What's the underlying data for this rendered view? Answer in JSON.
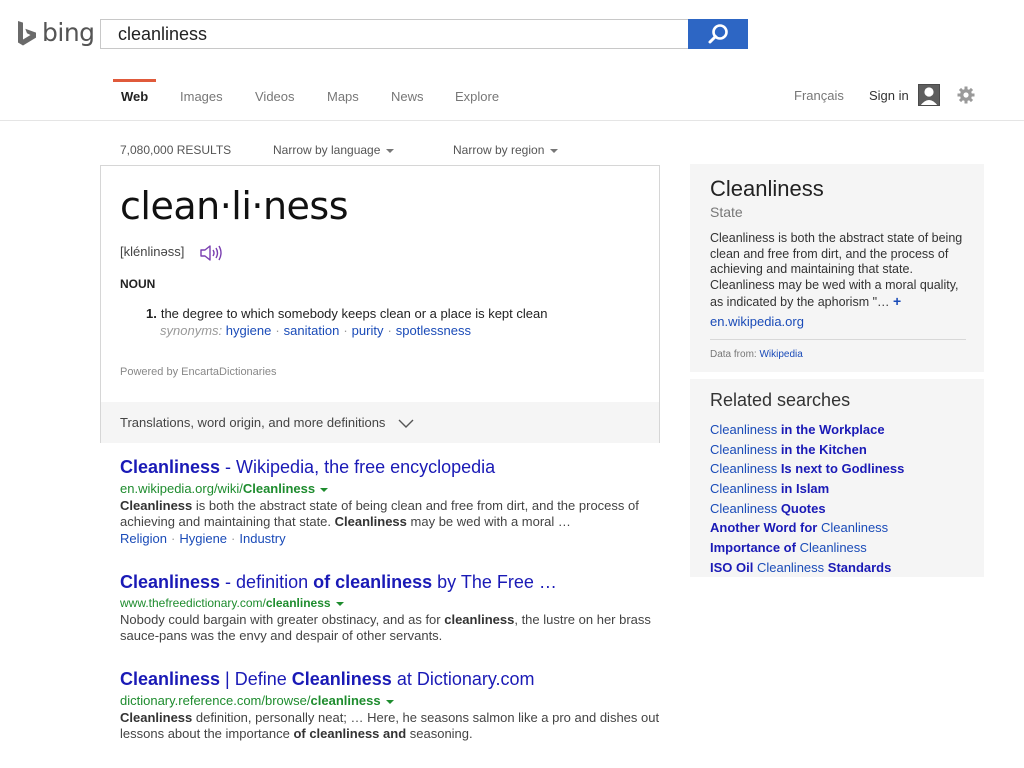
{
  "header": {
    "logo_text": "bing",
    "search_value": "cleanliness"
  },
  "nav": {
    "tabs": [
      {
        "label": "Web",
        "active": true
      },
      {
        "label": "Images"
      },
      {
        "label": "Videos"
      },
      {
        "label": "Maps"
      },
      {
        "label": "News"
      },
      {
        "label": "Explore"
      }
    ],
    "language": "Français",
    "signin": "Sign in"
  },
  "meta": {
    "results_count": "7,080,000 RESULTS",
    "narrow_language": "Narrow by language",
    "narrow_region": "Narrow by region"
  },
  "dictionary": {
    "word": "clean·li·ness",
    "pronunciation": "[klénlinəss]",
    "part_of_speech": "NOUN",
    "definition_number": "1.",
    "definition": "the degree to which somebody keeps clean or a place is kept clean",
    "synonyms_label": "synonyms:",
    "synonyms": [
      "hygiene",
      "sanitation",
      "purity",
      "spotlessness"
    ],
    "powered_by": "Powered by EncartaDictionaries",
    "more_label": "Translations, word origin, and more definitions"
  },
  "results": [
    {
      "title_bold": "Cleanliness",
      "title_rest": " - Wikipedia, the free encyclopedia",
      "url_plain": "en.wikipedia.org/wiki/",
      "url_bold": "Cleanliness",
      "snippet": [
        {
          "b": "Cleanliness"
        },
        {
          "t": " is both the abstract state of being clean and free from dirt, and the process of achieving and maintaining that state. "
        },
        {
          "b": "Cleanliness"
        },
        {
          "t": " may be wed with a moral …"
        }
      ],
      "deeplinks": [
        "Religion",
        "Hygiene",
        "Industry"
      ]
    },
    {
      "title_parts": [
        {
          "b": "Cleanliness"
        },
        {
          "t": " - definition "
        },
        {
          "b": "of cleanliness"
        },
        {
          "t": " by The Free …"
        }
      ],
      "url_plain": "www.thefreedictionary.com/",
      "url_bold": "cleanliness",
      "snippet": [
        {
          "t": "Nobody could bargain with greater obstinacy, and as for "
        },
        {
          "b": "cleanliness"
        },
        {
          "t": ", the lustre on her brass sauce-pans was the envy and despair of other servants."
        }
      ]
    },
    {
      "title_parts": [
        {
          "b": "Cleanliness"
        },
        {
          "t": " | Define "
        },
        {
          "b": "Cleanliness"
        },
        {
          "t": " at Dictionary.com"
        }
      ],
      "url_plain": "dictionary.reference.com/browse/",
      "url_bold": "cleanliness",
      "snippet": [
        {
          "b": "Cleanliness"
        },
        {
          "t": " definition, personally neat; … Here, he seasons salmon like a pro and dishes out lessons about the importance "
        },
        {
          "b": "of cleanliness and"
        },
        {
          "t": " seasoning."
        }
      ]
    }
  ],
  "knowledge_panel": {
    "title": "Cleanliness",
    "subtitle": "State",
    "description": "Cleanliness is both the abstract state of being clean and free from dirt, and the process of achieving and maintaining that state. Cleanliness may be wed with a moral quality, as indicated by the aphorism \"…",
    "more": "+",
    "link": "en.wikipedia.org",
    "source_label": "Data from:",
    "source_link": "Wikipedia"
  },
  "related": {
    "title": "Related searches",
    "items": [
      [
        {
          "t": "Cleanliness"
        },
        {
          "b": " in the Workplace"
        }
      ],
      [
        {
          "t": "Cleanliness"
        },
        {
          "b": " in the Kitchen"
        }
      ],
      [
        {
          "t": "Cleanliness"
        },
        {
          "b": " Is next to Godliness"
        }
      ],
      [
        {
          "t": "Cleanliness"
        },
        {
          "b": " in Islam"
        }
      ],
      [
        {
          "t": "Cleanliness"
        },
        {
          "b": " Quotes"
        }
      ],
      [
        {
          "b": "Another Word for"
        },
        {
          "t": " Cleanliness"
        }
      ],
      [
        {
          "b": "Importance of"
        },
        {
          "t": " Cleanliness"
        }
      ],
      [
        {
          "b": "ISO Oil"
        },
        {
          "t": " Cleanliness "
        },
        {
          "b": "Standards"
        }
      ]
    ]
  },
  "colors": {
    "link_blue": "#1a1ab6",
    "url_green": "#1e8c2e",
    "search_button": "#2d66c4",
    "active_tab_underline": "#e05a3b"
  }
}
